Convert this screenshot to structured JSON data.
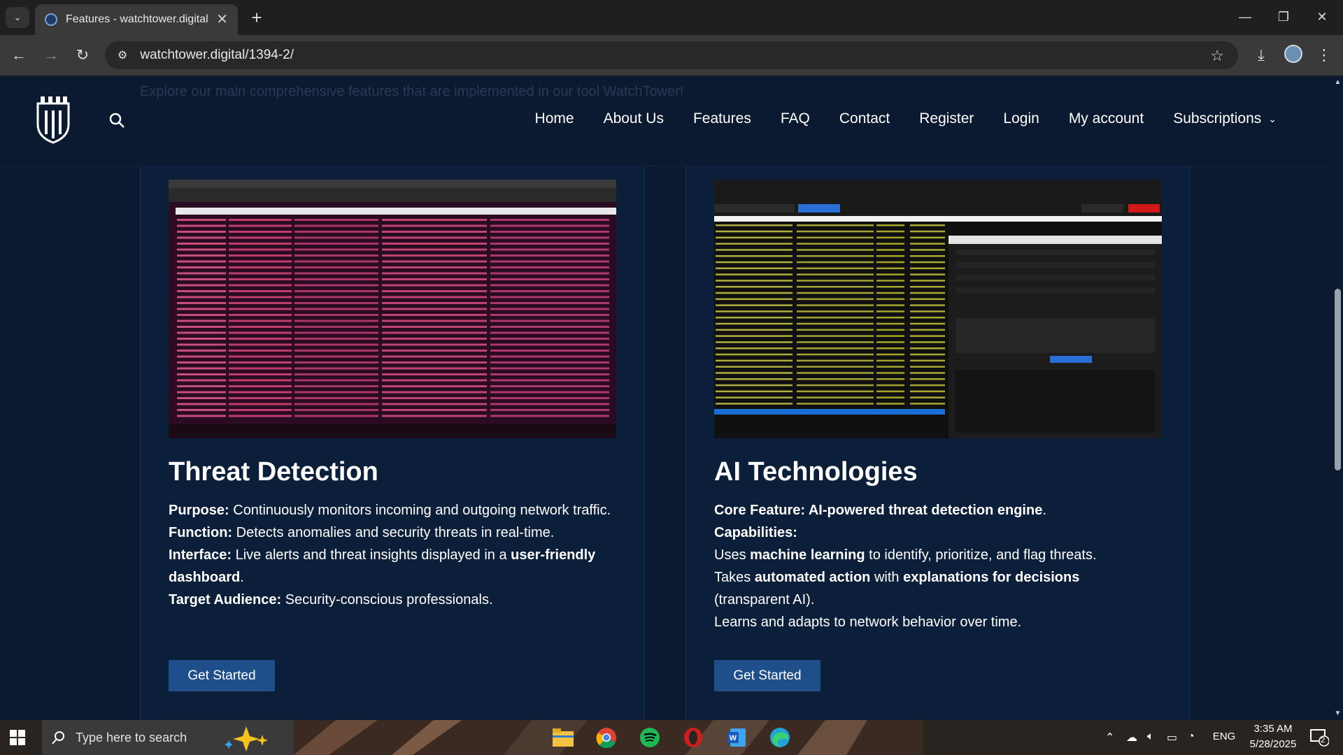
{
  "browser": {
    "tab_title": "Features - watchtower.digital",
    "url": "watchtower.digital/1394-2/",
    "close_glyph": "✕",
    "new_tab_glyph": "+",
    "minimize_glyph": "—",
    "restore_glyph": "❐",
    "win_close_glyph": "✕",
    "back_glyph": "←",
    "forward_glyph": "→",
    "reload_glyph": "↻",
    "site_info_glyph": "⚙",
    "star_glyph": "☆",
    "download_glyph": "⤓",
    "menu_glyph": "⋮",
    "tab_search_glyph": "⌄"
  },
  "site": {
    "faded_intro": "Explore our main comprehensive features that are implemented in our tool WatchTower!",
    "nav": {
      "home": "Home",
      "about": "About Us",
      "features": "Features",
      "faq": "FAQ",
      "contact": "Contact",
      "register": "Register",
      "login": "Login",
      "account": "My account",
      "subscriptions": "Subscriptions",
      "chevron": "⌄"
    }
  },
  "cards": {
    "threat": {
      "title": "Threat Detection",
      "purpose_label": "Purpose:",
      "purpose_text": " Continuously monitors incoming and outgoing network traffic.",
      "function_label": "Function:",
      "function_text": " Detects anomalies and security threats in real-time.",
      "interface_label": "Interface:",
      "interface_text": " Live alerts and threat insights displayed in a ",
      "interface_bold": "user-friendly dashboard",
      "interface_end": ".",
      "audience_label": "Target Audience:",
      "audience_text": " Security-conscious professionals.",
      "button": "Get Started"
    },
    "ai": {
      "title": "AI Technologies",
      "core_label": "Core Feature: AI-powered threat detection engine",
      "core_end": ".",
      "cap_label": "Capabilities:",
      "line1_a": "Uses ",
      "line1_b": "machine learning",
      "line1_c": " to identify, prioritize, and flag threats.",
      "line2_a": "Takes ",
      "line2_b": "automated action",
      "line2_c": " with ",
      "line2_d": "explanations for decisions",
      "line3": "(transparent AI).",
      "line4": "Learns and adapts to network behavior over time.",
      "button": "Get Started"
    }
  },
  "taskbar": {
    "search_placeholder": "Type here to search",
    "time": "3:35 AM",
    "date": "5/28/2025",
    "lang": "ENG",
    "notifications": "2"
  }
}
